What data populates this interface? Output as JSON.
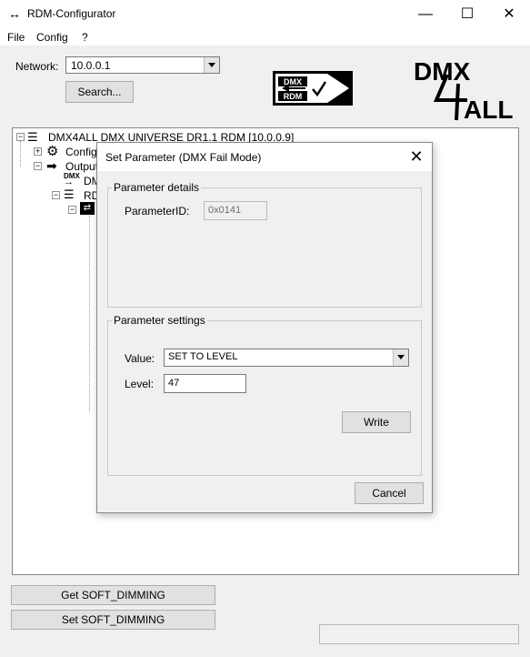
{
  "window": {
    "title": "RDM-Configurator",
    "icon": "double-arrow-icon",
    "controls": {
      "minimize": "—",
      "maximize": "☐",
      "close": "✕"
    }
  },
  "menu": [
    "File",
    "Config",
    "?"
  ],
  "network": {
    "label": "Network:",
    "value": "10.0.0.1",
    "search_label": "Search..."
  },
  "logos": {
    "dmx_rdm_top": "DMX",
    "dmx_rdm_bottom": "RDM",
    "brand_top": "DMX",
    "brand_bottom": "ALL",
    "brand_digit": "4"
  },
  "tree": {
    "root": "DMX4ALL DMX UNIVERSE DR1.1 RDM [10.0.0.9]",
    "items": [
      "Configu",
      "Output",
      "DM",
      "RD"
    ],
    "dmx_badge": "DMX"
  },
  "dialog": {
    "title": "Set Parameter (DMX Fail Mode)",
    "close": "✕",
    "details": {
      "title": "Parameter details",
      "pid_label": "ParameterID:",
      "pid_value": "0x0141"
    },
    "settings": {
      "title": "Parameter settings",
      "value_label": "Value:",
      "value": "SET TO LEVEL",
      "level_label": "Level:",
      "level": "47",
      "write_label": "Write"
    },
    "cancel_label": "Cancel"
  },
  "buttons": {
    "get": "Get SOFT_DIMMING",
    "set": "Set SOFT_DIMMING"
  },
  "colors": {
    "background": "#f0f0f0",
    "window": "#ffffff"
  }
}
